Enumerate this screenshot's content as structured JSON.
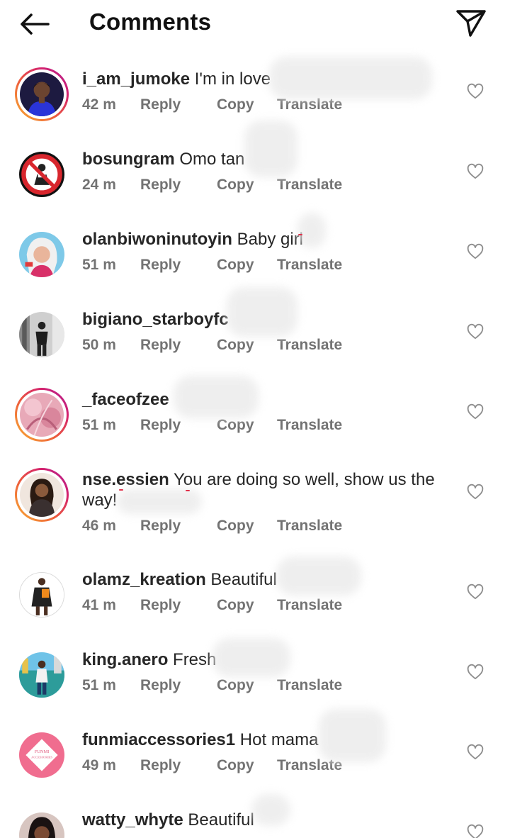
{
  "header": {
    "title": "Comments",
    "back_icon": "arrow-left-icon",
    "send_icon": "paper-plane-icon"
  },
  "actions": {
    "reply": "Reply",
    "copy": "Copy",
    "translate": "Translate"
  },
  "comments": [
    {
      "username": "i_am_jumoke",
      "text": "I'm in love",
      "time": "42 m",
      "ring": true
    },
    {
      "username": "bosungram",
      "text": "Omo tan",
      "time": "24 m",
      "ring": false
    },
    {
      "username": "olanbiwoninutoyin",
      "text": "Baby girl",
      "time": "51 m",
      "ring": false
    },
    {
      "username": "bigiano_starboyfc",
      "text": "",
      "time": "50 m",
      "ring": false
    },
    {
      "username": "_faceofzee",
      "text": "",
      "time": "51 m",
      "ring": true
    },
    {
      "username": "nse.essien",
      "text": "You are doing so well,  show us the way!",
      "time": "46 m",
      "ring": true
    },
    {
      "username": "olamz_kreation",
      "text": "Beautiful",
      "time": "41 m",
      "ring": false
    },
    {
      "username": "king.anero",
      "text": "Fresh",
      "time": "51 m",
      "ring": false
    },
    {
      "username": "funmiaccessories1",
      "text": "Hot mama",
      "time": "49 m",
      "ring": false
    },
    {
      "username": "watty_whyte",
      "text": "Beautiful",
      "time": "",
      "ring": false
    }
  ],
  "avatar_art": {
    "funmi_logo_line1": "FUNMI",
    "funmi_logo_line2": "ACCESSORIES"
  },
  "colors": {
    "text": "#262626",
    "meta": "#737373",
    "ring_start": "#f9b233",
    "ring_end": "#a8229c",
    "heart_stroke": "#8e8e8e"
  },
  "icons": {
    "like": "heart-outline-icon"
  }
}
